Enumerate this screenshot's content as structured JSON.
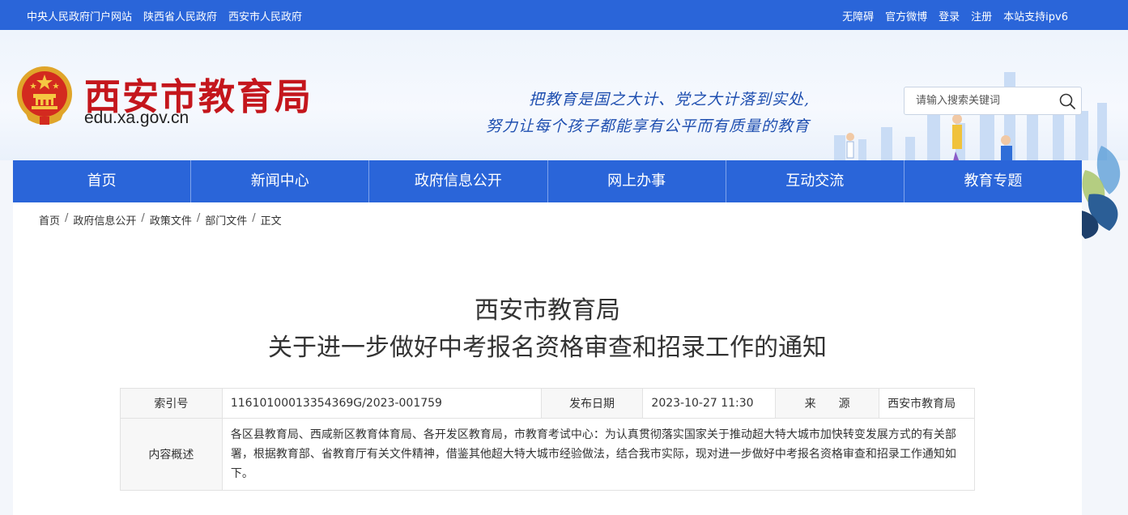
{
  "topbar": {
    "left_links": [
      "中央人民政府门户网站",
      "陕西省人民政府",
      "西安市人民政府"
    ],
    "right_links": [
      "无障碍",
      "官方微博",
      "登录",
      "注册",
      "本站支持ipv6"
    ]
  },
  "header": {
    "site_name": "西安市教育局",
    "domain": "edu.xa.gov.cn",
    "slogan_line1": "把教育是国之大计、党之大计落到实处,",
    "slogan_line2": "努力让每个孩子都能享有公平而有质量的教育",
    "search_placeholder": "请输入搜索关键词"
  },
  "nav": {
    "items": [
      "首页",
      "新闻中心",
      "政府信息公开",
      "网上办事",
      "互动交流",
      "教育专题"
    ]
  },
  "breadcrumb": {
    "items": [
      "首页",
      "政府信息公开",
      "政策文件",
      "部门文件",
      "正文"
    ],
    "separator": "/"
  },
  "article": {
    "title_line1": "西安市教育局",
    "title_line2": "关于进一步做好中考报名资格审查和招录工作的通知"
  },
  "meta": {
    "index_label": "索引号",
    "index_value": "11610100013354369G/2023-001759",
    "date_label": "发布日期",
    "date_value": "2023-10-27 11:30",
    "source_label": "来　　源",
    "source_value": "西安市教育局",
    "summary_label": "内容概述",
    "summary_value": "各区县教育局、西咸新区教育体育局、各开发区教育局，市教育考试中心：为认真贯彻落实国家关于推动超大特大城市加快转变发展方式的有关部署，根据教育部、省教育厅有关文件精神，借鉴其他超大特大城市经验做法，结合我市实际，现对进一步做好中考报名资格审查和招录工作通知如下。"
  },
  "colors": {
    "brand_blue": "#2a65d9",
    "title_red": "#c4161c",
    "slogan_blue": "#1f4fb0"
  },
  "icons": {
    "emblem": "national-emblem-icon",
    "search": "search-icon"
  }
}
